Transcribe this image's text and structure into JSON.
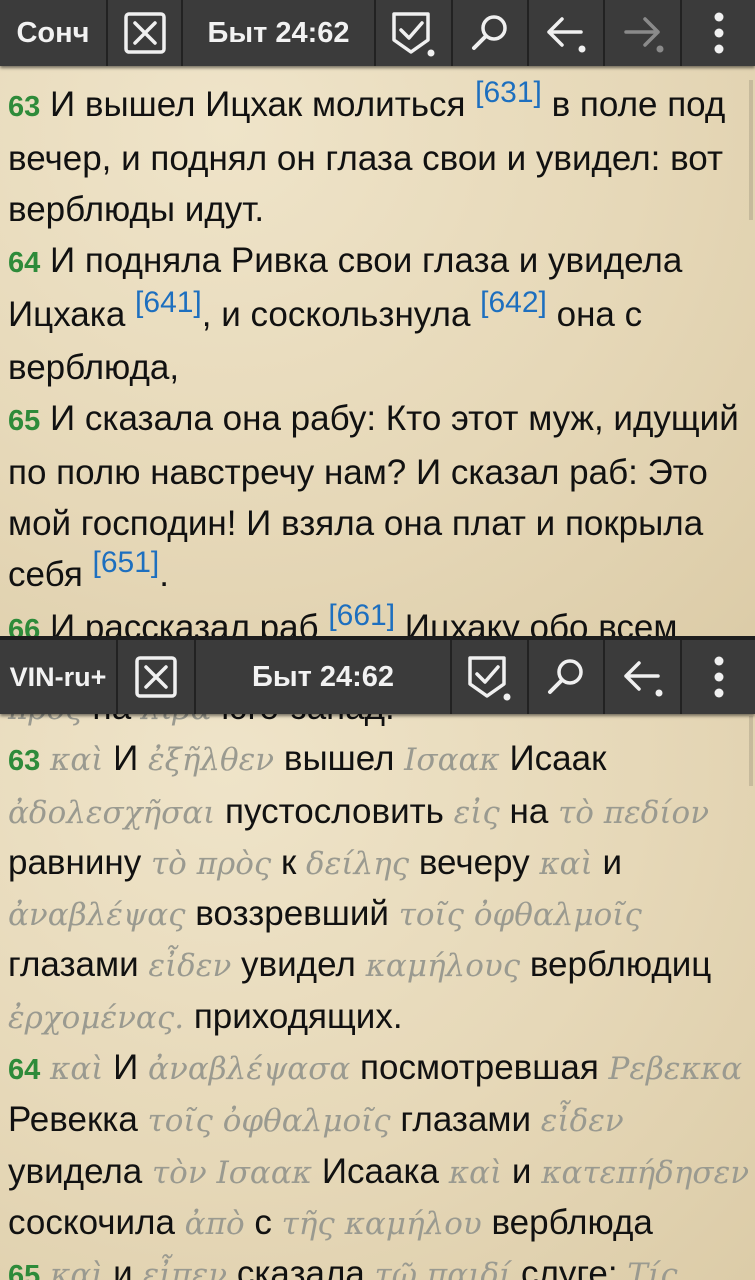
{
  "top_pane": {
    "toolbar": {
      "module": "Сонч",
      "reference": "Быт 24:62"
    },
    "verses": [
      {
        "num": "63",
        "parts": [
          {
            "t": "И вышел Ицхак молиться "
          },
          {
            "fn": "[631]"
          },
          {
            "t": " в поле под вечер, и поднял он глаза свои и увидел: вот верблюды идут."
          }
        ]
      },
      {
        "num": "64",
        "parts": [
          {
            "t": "И подняла Ривка свои глаза и увидела Ицхака "
          },
          {
            "fn": "[641]"
          },
          {
            "t": ", и соскользнула "
          },
          {
            "fn": "[642]"
          },
          {
            "t": " она с верблюда,"
          }
        ]
      },
      {
        "num": "65",
        "parts": [
          {
            "t": "И сказала она рабу: Кто этот муж, идущий по полю навстречу нам? И сказал раб: Это мой господин! И взяла она плат и покрыла себя "
          },
          {
            "fn": "[651]"
          },
          {
            "t": "."
          }
        ]
      },
      {
        "num": "66",
        "parts": [
          {
            "t": "И рассказал раб "
          },
          {
            "fn": "[661]"
          },
          {
            "t": " Ицхаку обо всем"
          }
        ]
      }
    ]
  },
  "bottom_pane": {
    "toolbar": {
      "module": "VIN-ru+",
      "reference": "Быт 24:62"
    },
    "cut_line": [
      {
        "g": "πρὸς"
      },
      {
        "r": "на"
      },
      {
        "g": "λίβα"
      },
      {
        "r": "юго-запад."
      }
    ],
    "verses": [
      {
        "num": "63",
        "parts": [
          {
            "g": "καὶ"
          },
          {
            "r": "И"
          },
          {
            "g": "ἐξῆλθεν"
          },
          {
            "r": "вышел"
          },
          {
            "g": "Ισαακ"
          },
          {
            "r": "Исаак"
          },
          {
            "g": "ἀδολεσχῆσαι"
          },
          {
            "r": "пустословить"
          },
          {
            "g": "εἰς"
          },
          {
            "r": "на"
          },
          {
            "g": "τὸ πεδίον"
          },
          {
            "r": "равнину"
          },
          {
            "g": "τὸ πρὸς"
          },
          {
            "r": "к"
          },
          {
            "g": "δείλης"
          },
          {
            "r": "вечеру"
          },
          {
            "g": "καὶ"
          },
          {
            "r": "и"
          },
          {
            "g": "ἀναβλέψας"
          },
          {
            "r": "воззревший"
          },
          {
            "g": "τοῖς ὀφθαλμοῖς"
          },
          {
            "r": "глазами"
          },
          {
            "g": "εἶδεν"
          },
          {
            "r": "увидел"
          },
          {
            "g": "καμήλους"
          },
          {
            "r": "верблюдиц"
          },
          {
            "g": "ἐρχομένας."
          },
          {
            "r": "приходящих."
          }
        ]
      },
      {
        "num": "64",
        "parts": [
          {
            "g": "καὶ"
          },
          {
            "r": "И"
          },
          {
            "g": "ἀναβλέψασα"
          },
          {
            "r": "посмотревшая"
          },
          {
            "g": "Ρεβεκκα"
          },
          {
            "r": "Ревекка"
          },
          {
            "g": "τοῖς ὀφθαλμοῖς"
          },
          {
            "r": "глазами"
          },
          {
            "g": "εἶδεν"
          },
          {
            "r": "увидела"
          },
          {
            "g": "τὸν Ισαακ"
          },
          {
            "r": "Исаака"
          },
          {
            "g": "καὶ"
          },
          {
            "r": "и"
          },
          {
            "g": "κατεπήδησεν"
          },
          {
            "r": "соскочила"
          },
          {
            "g": "ἀπὸ"
          },
          {
            "r": "с"
          },
          {
            "g": "τῆς καμήλου"
          },
          {
            "r": "верблюда"
          }
        ]
      },
      {
        "num": "65",
        "parts": [
          {
            "g": "καὶ"
          },
          {
            "r": "и"
          },
          {
            "g": "εἶπεν"
          },
          {
            "r": "сказала"
          },
          {
            "g": "τῷ παιδί"
          },
          {
            "r": "слуге:"
          },
          {
            "g": "Τίς"
          }
        ]
      }
    ]
  },
  "colors": {
    "toolbar_bg": "#3b3b3b",
    "verse_number": "#2e8b3a",
    "footnote": "#1d6fbf",
    "greek": "#9a9a90",
    "paper": "#e8dcc0"
  },
  "icons": [
    "close-icon",
    "bookmark-check-icon",
    "search-icon",
    "back-arrow-icon",
    "forward-arrow-icon",
    "more-vert-icon"
  ]
}
